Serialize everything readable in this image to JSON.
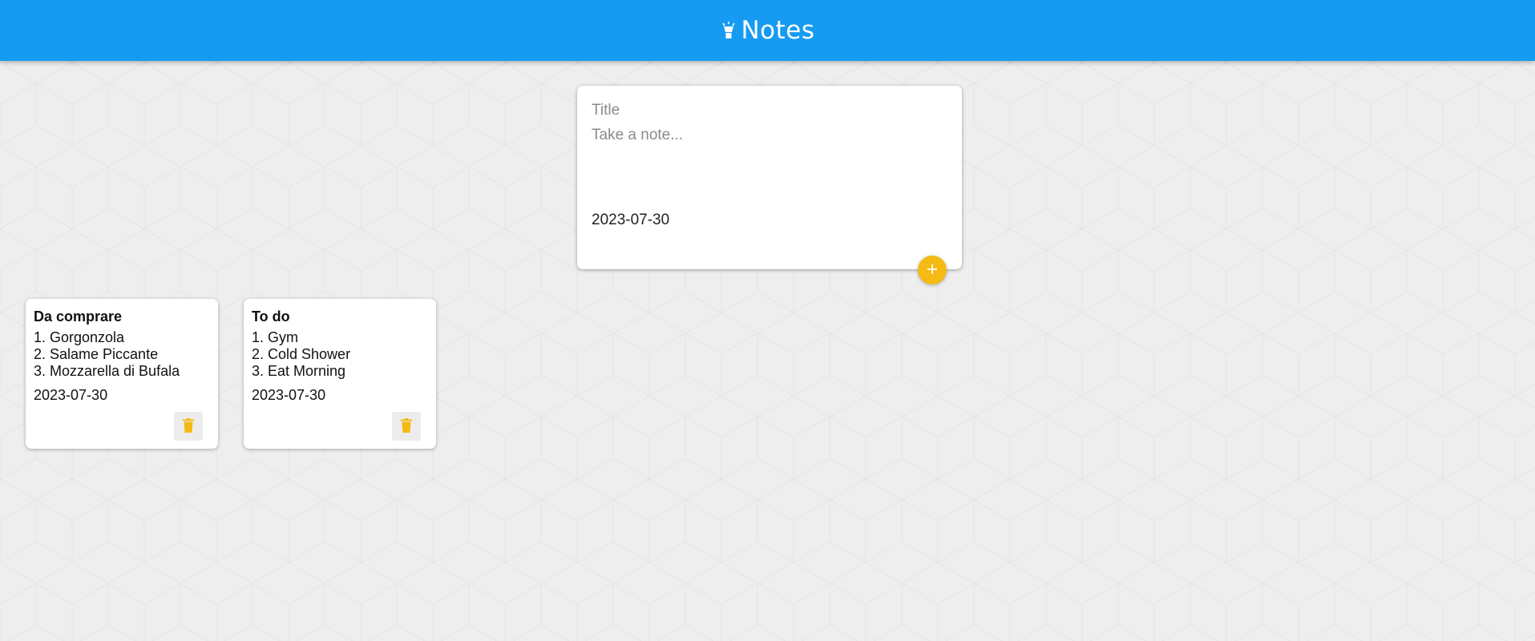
{
  "header": {
    "title": "Notes",
    "logo_icon": "lightbulb-icon",
    "background_color": "#169bf3"
  },
  "composer": {
    "title_placeholder": "Title",
    "note_placeholder": "Take a note...",
    "date": "2023-07-30",
    "add_icon": "plus-icon",
    "accent_color": "#f5ba13"
  },
  "notes": [
    {
      "title": "Da comprare",
      "lines": [
        "1. Gorgonzola",
        "2. Salame Piccante",
        "3. Mozzarella di Bufala"
      ],
      "date": "2023-07-30",
      "delete_icon": "trash-icon"
    },
    {
      "title": "To do",
      "lines": [
        "1. Gym",
        "2. Cold Shower",
        "3. Eat Morning"
      ],
      "date": "2023-07-30",
      "delete_icon": "trash-icon"
    }
  ]
}
